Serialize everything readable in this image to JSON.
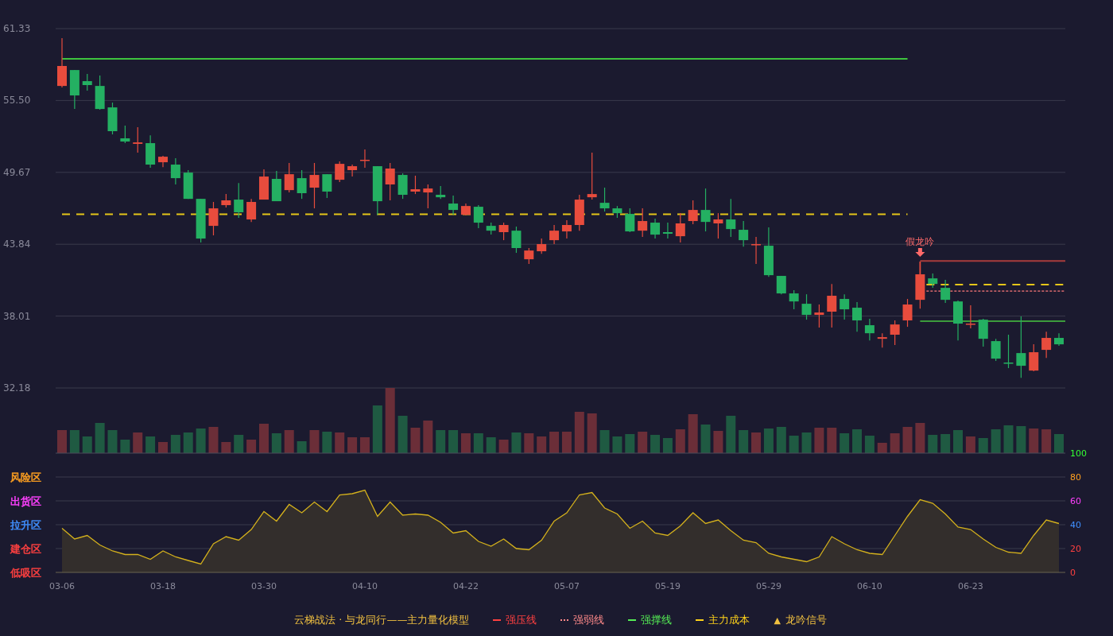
{
  "price_chart": {
    "chart_data": {
      "type": "candlestick",
      "grid": true,
      "ylim": [
        32.18,
        61.33
      ],
      "yticks": [
        {
          "value": 61.33,
          "label": "61.33"
        },
        {
          "value": 55.5,
          "label": "55.50"
        },
        {
          "value": 49.67,
          "label": "49.67"
        },
        {
          "value": 43.84,
          "label": "43.84"
        },
        {
          "value": 38.01,
          "label": "38.01"
        },
        {
          "value": 32.18,
          "label": "32.18"
        }
      ],
      "ohlc": [
        [
          56.68,
          60.55,
          56.55,
          58.3
        ],
        [
          57.97,
          57.97,
          54.81,
          55.91
        ],
        [
          57.07,
          57.65,
          56.3,
          56.75
        ],
        [
          56.68,
          57.52,
          54.75,
          54.81
        ],
        [
          54.94,
          55.33,
          52.75,
          53.01
        ],
        [
          52.43,
          53.46,
          52.04,
          52.17
        ],
        [
          51.98,
          53.33,
          51.27,
          52.1
        ],
        [
          52.04,
          52.68,
          50.04,
          50.3
        ],
        [
          50.49,
          51.01,
          50.1,
          50.94
        ],
        [
          50.3,
          50.81,
          48.69,
          49.2
        ],
        [
          49.65,
          49.85,
          47.52,
          47.52
        ],
        [
          47.52,
          47.52,
          43.98,
          44.3
        ],
        [
          45.33,
          47.27,
          44.56,
          46.75
        ],
        [
          47.01,
          47.91,
          46.82,
          47.4
        ],
        [
          47.46,
          48.81,
          45.98,
          46.43
        ],
        [
          45.85,
          47.52,
          45.65,
          47.27
        ],
        [
          47.46,
          49.91,
          47.46,
          49.33
        ],
        [
          49.14,
          49.78,
          47.33,
          47.33
        ],
        [
          48.23,
          50.43,
          48.04,
          49.52
        ],
        [
          49.2,
          49.85,
          47.52,
          47.98
        ],
        [
          48.43,
          50.43,
          46.75,
          49.46
        ],
        [
          49.52,
          49.52,
          47.59,
          48.11
        ],
        [
          49.07,
          50.56,
          48.88,
          50.36
        ],
        [
          49.85,
          50.3,
          49.33,
          50.17
        ],
        [
          50.62,
          51.52,
          50.04,
          50.69
        ],
        [
          50.17,
          50.17,
          46.23,
          47.33
        ],
        [
          48.69,
          50.43,
          47.4,
          49.98
        ],
        [
          49.46,
          49.59,
          47.52,
          47.85
        ],
        [
          48.11,
          49.4,
          47.91,
          48.3
        ],
        [
          48.04,
          48.69,
          46.75,
          48.36
        ],
        [
          47.85,
          48.56,
          47.52,
          47.65
        ],
        [
          47.14,
          47.78,
          46.23,
          46.62
        ],
        [
          46.23,
          47.14,
          46.17,
          46.94
        ],
        [
          46.88,
          47.01,
          45.14,
          45.59
        ],
        [
          45.33,
          45.59,
          44.62,
          44.94
        ],
        [
          44.82,
          45.59,
          44.17,
          45.4
        ],
        [
          44.94,
          45.27,
          43.14,
          43.53
        ],
        [
          42.62,
          43.53,
          42.24,
          43.33
        ],
        [
          43.27,
          44.3,
          43.07,
          43.85
        ],
        [
          44.17,
          45.4,
          43.85,
          44.94
        ],
        [
          44.88,
          45.78,
          44.3,
          45.4
        ],
        [
          45.4,
          47.85,
          44.94,
          47.46
        ],
        [
          47.65,
          51.27,
          47.46,
          47.91
        ],
        [
          47.2,
          48.43,
          46.49,
          46.75
        ],
        [
          46.75,
          46.94,
          45.98,
          46.36
        ],
        [
          46.3,
          46.75,
          44.82,
          44.88
        ],
        [
          44.94,
          46.75,
          44.43,
          45.72
        ],
        [
          45.59,
          45.91,
          44.3,
          44.62
        ],
        [
          44.82,
          45.59,
          44.3,
          44.69
        ],
        [
          44.49,
          46.36,
          43.98,
          45.53
        ],
        [
          45.72,
          47.4,
          45.46,
          46.62
        ],
        [
          46.62,
          48.36,
          44.88,
          45.65
        ],
        [
          45.53,
          46.36,
          44.3,
          45.85
        ],
        [
          45.85,
          47.52,
          44.43,
          45.07
        ],
        [
          45.01,
          45.72,
          43.65,
          44.17
        ],
        [
          43.78,
          44.43,
          42.24,
          43.85
        ],
        [
          43.72,
          45.2,
          41.2,
          41.33
        ],
        [
          41.27,
          41.27,
          39.78,
          39.85
        ],
        [
          39.85,
          40.11,
          38.56,
          39.2
        ],
        [
          39.01,
          39.78,
          37.72,
          38.11
        ],
        [
          38.11,
          38.95,
          37.08,
          38.3
        ],
        [
          38.37,
          40.62,
          37.08,
          39.66
        ],
        [
          39.4,
          39.78,
          37.72,
          38.56
        ],
        [
          38.69,
          39.14,
          36.75,
          37.66
        ],
        [
          37.27,
          37.79,
          36.04,
          36.62
        ],
        [
          36.17,
          36.62,
          35.46,
          36.3
        ],
        [
          36.5,
          37.66,
          35.66,
          37.33
        ],
        [
          37.66,
          39.4,
          37.14,
          38.95
        ],
        [
          39.33,
          42.43,
          38.62,
          41.4
        ],
        [
          41.07,
          41.46,
          40.3,
          40.62
        ],
        [
          40.3,
          40.95,
          39.08,
          39.33
        ],
        [
          39.2,
          39.27,
          36.04,
          37.4
        ],
        [
          37.33,
          38.88,
          37.01,
          37.4
        ],
        [
          37.72,
          37.79,
          35.53,
          36.17
        ],
        [
          35.98,
          36.17,
          34.37,
          34.56
        ],
        [
          34.24,
          36.5,
          33.79,
          34.17
        ],
        [
          35.01,
          37.98,
          33.01,
          33.98
        ],
        [
          33.59,
          35.72,
          33.53,
          35.08
        ],
        [
          35.27,
          36.75,
          34.62,
          36.24
        ],
        [
          36.24,
          36.62,
          35.59,
          35.72
        ]
      ],
      "ref_lines": [
        {
          "axis": "y",
          "value": 58.88,
          "color": "#3ec43e"
        },
        {
          "axis": "y",
          "value": 46.27,
          "color": "#e6c619"
        },
        {
          "axis": "y",
          "value": 42.49,
          "color": "#a83c3c"
        },
        {
          "axis": "y",
          "value": 40.56,
          "color": "#e6c619"
        },
        {
          "axis": "y",
          "value": 40.04,
          "color": "#ff7a7a"
        },
        {
          "axis": "y",
          "value": 37.59,
          "color": "#3c9c3c"
        }
      ],
      "annotations": [
        {
          "y": 42.43,
          "text": "假龙吟"
        }
      ]
    }
  },
  "indicator": {
    "zones": [
      {
        "label": "风险区",
        "color": "#ffa020"
      },
      {
        "label": "出货区",
        "color": "#ff40ff"
      },
      {
        "label": "拉升区",
        "color": "#4090ff"
      },
      {
        "label": "建仓区",
        "color": "#ff4040"
      },
      {
        "label": "低吸区",
        "color": "#ff4040"
      }
    ],
    "chart_data": {
      "type": "area",
      "grid": true,
      "ylim": [
        0,
        100
      ],
      "yticks": [
        {
          "value": 100,
          "label": "100"
        },
        {
          "value": 80,
          "label": "80"
        },
        {
          "value": 60,
          "label": "60"
        },
        {
          "value": 40,
          "label": "40"
        },
        {
          "value": 20,
          "label": "20"
        },
        {
          "value": 0,
          "label": "0"
        }
      ],
      "categories": [
        "03-06",
        null,
        null,
        null,
        null,
        null,
        null,
        null,
        "03-18",
        null,
        null,
        null,
        null,
        null,
        null,
        null,
        "03-30",
        null,
        null,
        null,
        null,
        null,
        null,
        null,
        "04-10",
        null,
        null,
        null,
        null,
        null,
        null,
        null,
        "04-22",
        null,
        null,
        null,
        null,
        null,
        null,
        null,
        "05-07",
        null,
        null,
        null,
        null,
        null,
        null,
        null,
        "05-19",
        null,
        null,
        null,
        null,
        null,
        null,
        null,
        "05-29",
        null,
        null,
        null,
        null,
        null,
        null,
        null,
        "06-10",
        null,
        null,
        null,
        null,
        null,
        null,
        null,
        "06-23",
        null,
        null,
        null,
        null,
        null,
        null,
        null
      ],
      "series": [
        {
          "color": "#d4b11c",
          "values": [
            37,
            28,
            31,
            23,
            18,
            15,
            15,
            11,
            18,
            13,
            10,
            7,
            24,
            30,
            27,
            36,
            51,
            43,
            57,
            50,
            59,
            51,
            65,
            66,
            69,
            47,
            59,
            48,
            49,
            48,
            42,
            33,
            35,
            26,
            22,
            28,
            20,
            19,
            27,
            43,
            50,
            65,
            67,
            54,
            49,
            37,
            43,
            33,
            31,
            39,
            50,
            41,
            44,
            35,
            27,
            25,
            16,
            13,
            11,
            9,
            13,
            30,
            24,
            19,
            16,
            15,
            31,
            47,
            61,
            58,
            49,
            38,
            36,
            28,
            21,
            17,
            16,
            31,
            44,
            41
          ]
        }
      ]
    }
  },
  "legend": {
    "title": "云梯战法 · 与龙同行——主力量化模型",
    "items": [
      {
        "kind": "line",
        "label": "强压线",
        "color": "#ff4040"
      },
      {
        "kind": "dotted",
        "label": "强弱线",
        "color": "#ff8a8a"
      },
      {
        "kind": "line",
        "label": "强撑线",
        "color": "#55ee55"
      },
      {
        "kind": "dashed",
        "label": "主力成本",
        "color": "#ffd21a"
      },
      {
        "kind": "marker",
        "symbol": "▲",
        "label": "龙吟信号",
        "color": "#f0c040"
      }
    ]
  }
}
